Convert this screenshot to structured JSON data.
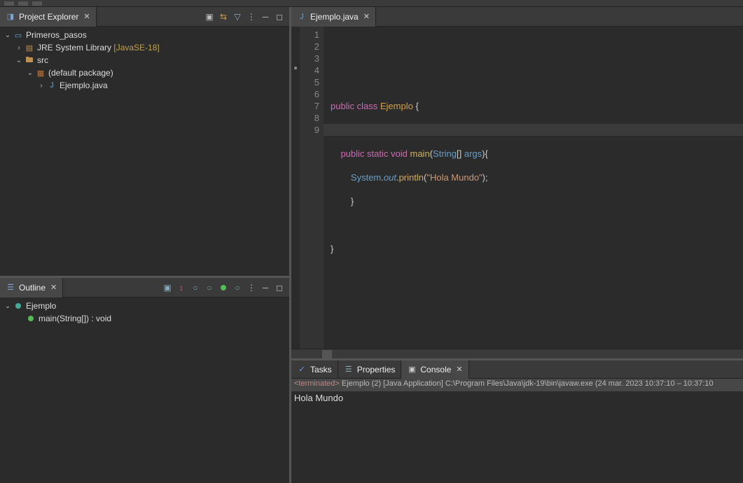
{
  "explorer": {
    "title": "Project Explorer",
    "tree": {
      "project": "Primeros_pasos",
      "jre_lib": "JRE System Library",
      "jre_qual": "[JavaSE-18]",
      "src": "src",
      "pkg": "(default package)",
      "file": "Ejemplo.java"
    },
    "toolbar_icons": [
      "collapse-all",
      "link-editor",
      "filter",
      "menu",
      "minimize",
      "maximize"
    ]
  },
  "outline": {
    "title": "Outline",
    "class": "Ejemplo",
    "method": "main(String[]) : void"
  },
  "editor": {
    "tab": "Ejemplo.java",
    "lines": [
      "1",
      "2",
      "3",
      "4",
      "5",
      "6",
      "7",
      "8",
      "9"
    ],
    "code": {
      "l2_kw1": "public",
      "l2_kw2": "class",
      "l2_cls": "Ejemplo",
      "l2_brace": "{",
      "l4_kw1": "public",
      "l4_kw2": "static",
      "l4_kw3": "void",
      "l4_mth": "main",
      "l4_p1": "(",
      "l4_typ": "String",
      "l4_arr": "[]",
      "l4_arg": "args",
      "l4_p2": "){",
      "l5_sys": "System",
      "l5_d1": ".",
      "l5_out": "out",
      "l5_d2": ".",
      "l5_prn": "println",
      "l5_p1": "(",
      "l5_str": "\"Hola Mundo\"",
      "l5_p2": ");",
      "l6_brace": "}",
      "l8_brace": "}"
    }
  },
  "bottom": {
    "tabs": {
      "tasks": "Tasks",
      "properties": "Properties",
      "console": "Console"
    },
    "status_prefix": "<terminated>",
    "status_rest": " Ejemplo (2) [Java Application] C:\\Program Files\\Java\\jdk-19\\bin\\javaw.exe  (24 mar. 2023 10:37:10 – 10:37:10",
    "output": "Hola Mundo"
  }
}
